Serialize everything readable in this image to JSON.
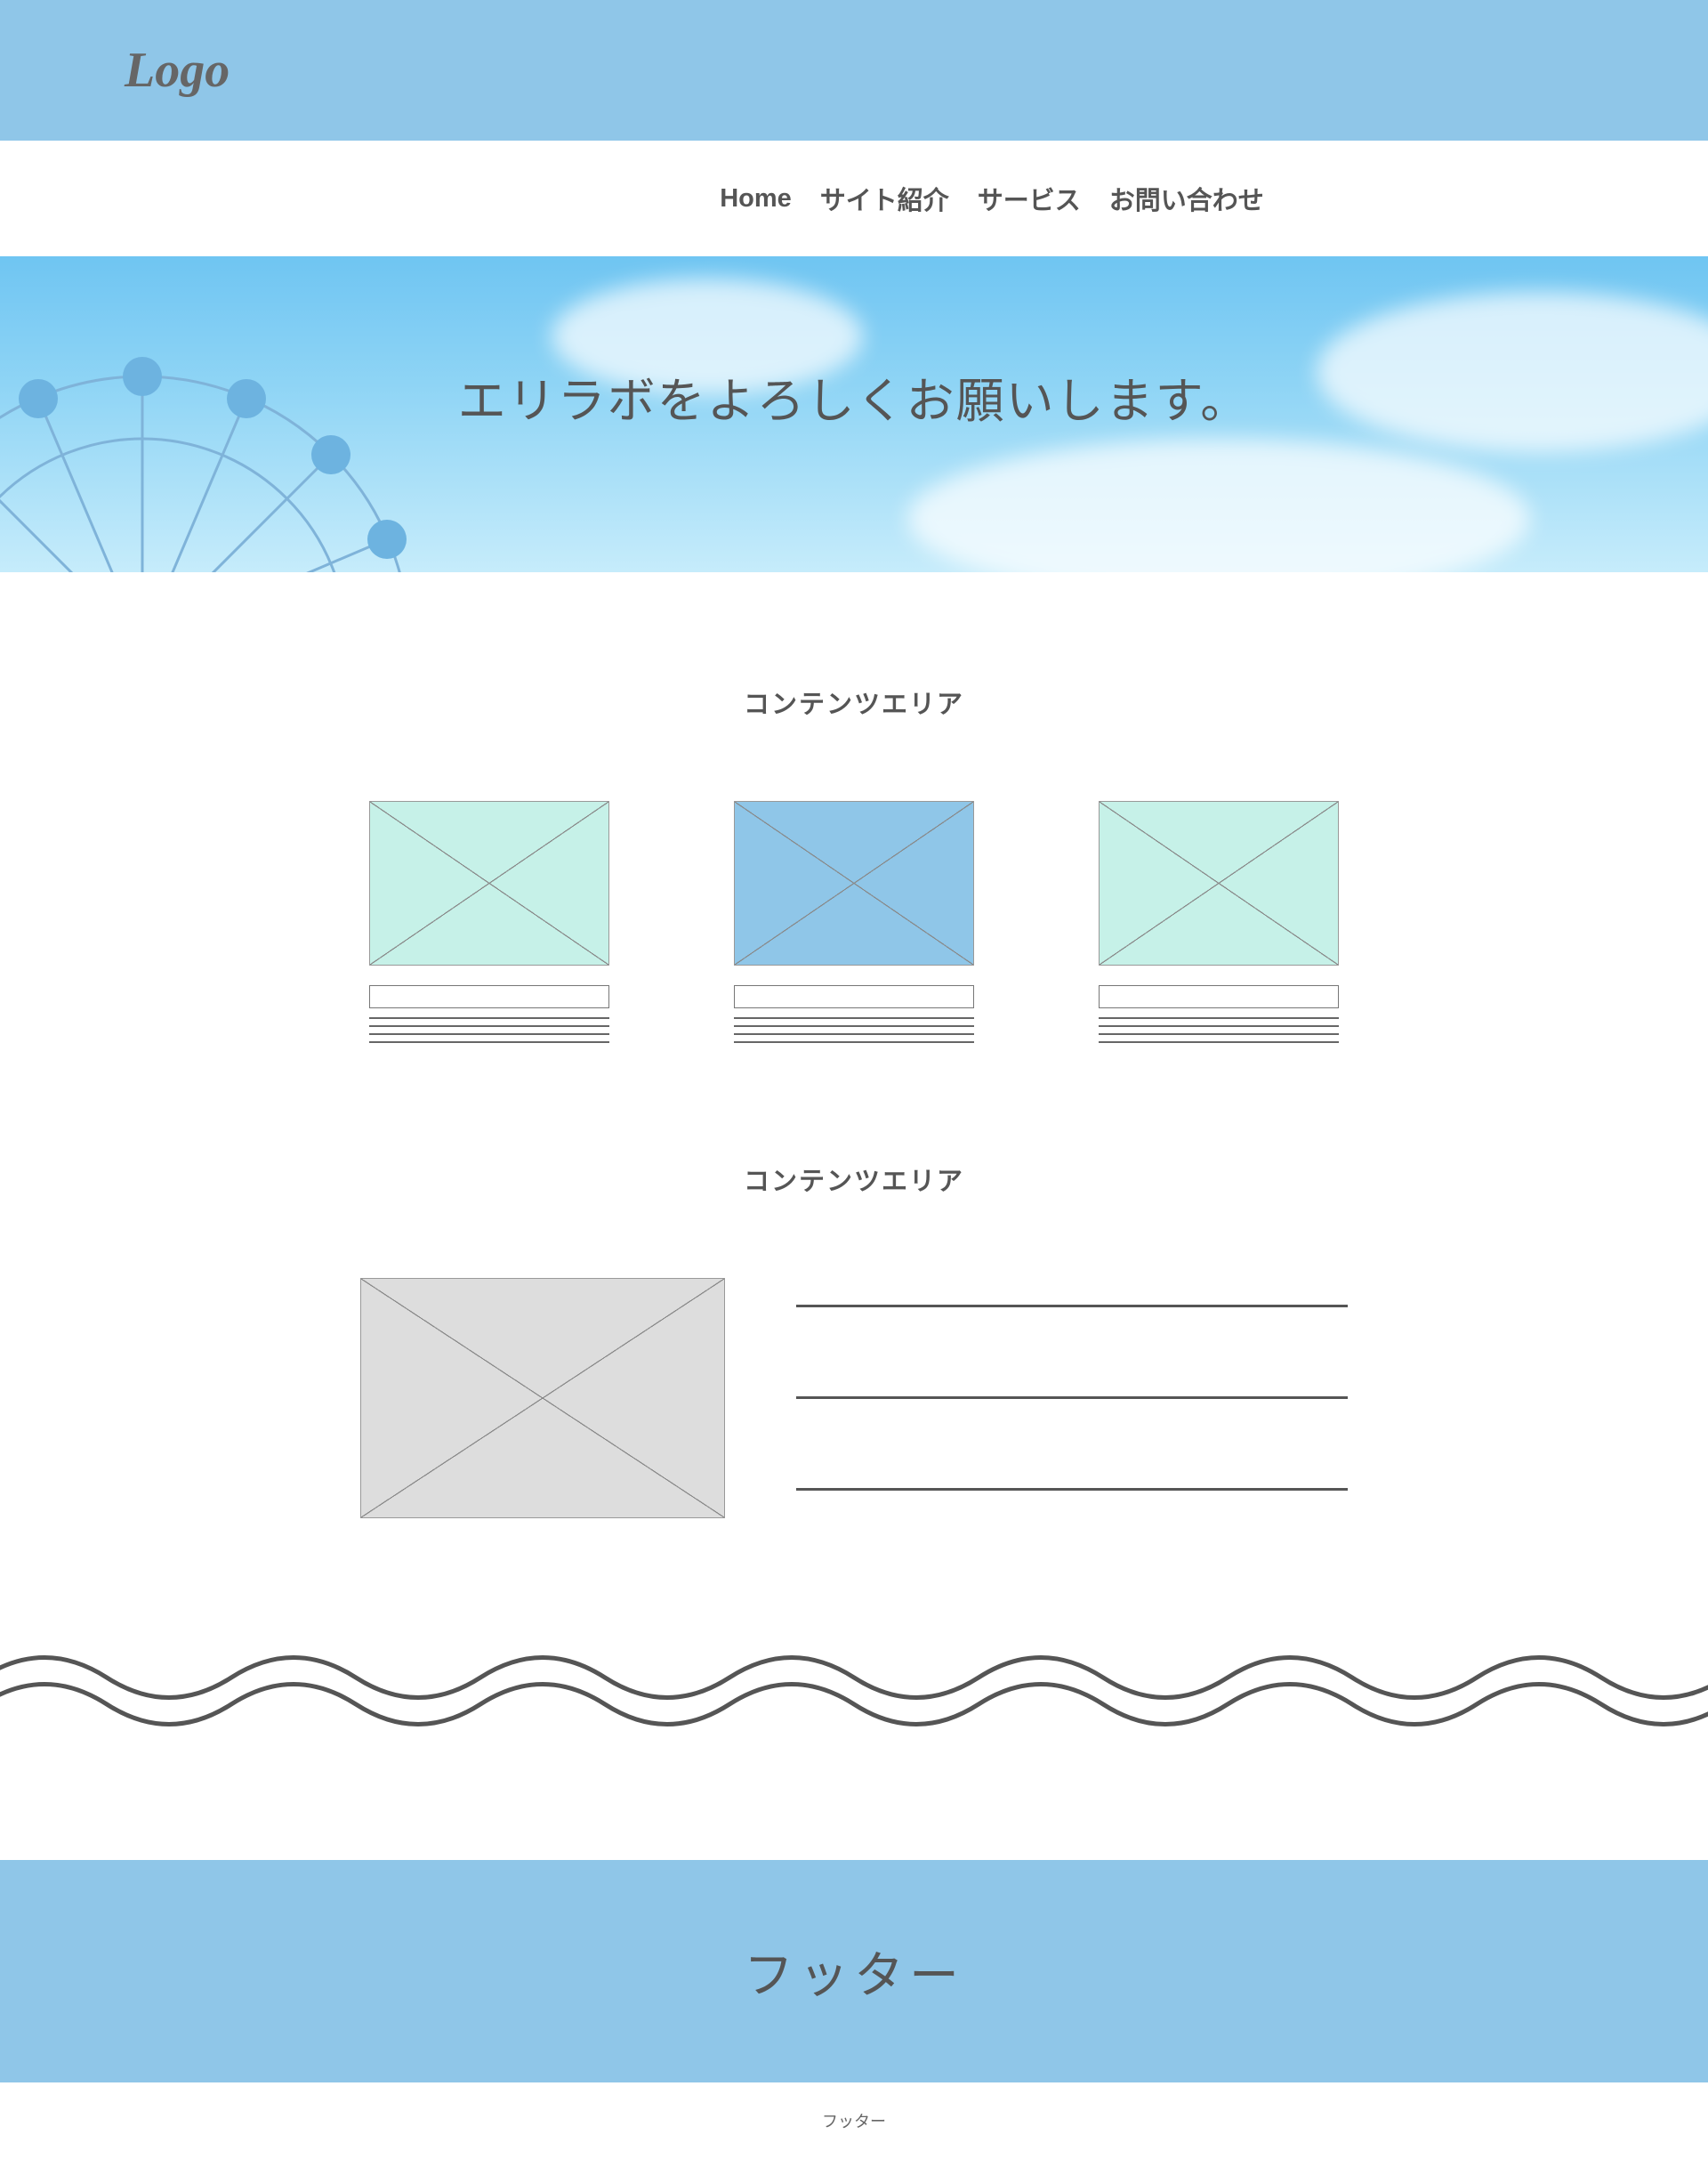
{
  "logo": "Logo",
  "nav": {
    "items": [
      "Home",
      "サイト紹介",
      "サービス",
      "お問い合わせ"
    ]
  },
  "hero": {
    "title": "エリラボをよろしくお願いします。"
  },
  "section1": {
    "title": "コンテンツエリア"
  },
  "section2": {
    "title": "コンテンツエリア"
  },
  "footer": {
    "title": "フッター",
    "sub": "フッター"
  }
}
